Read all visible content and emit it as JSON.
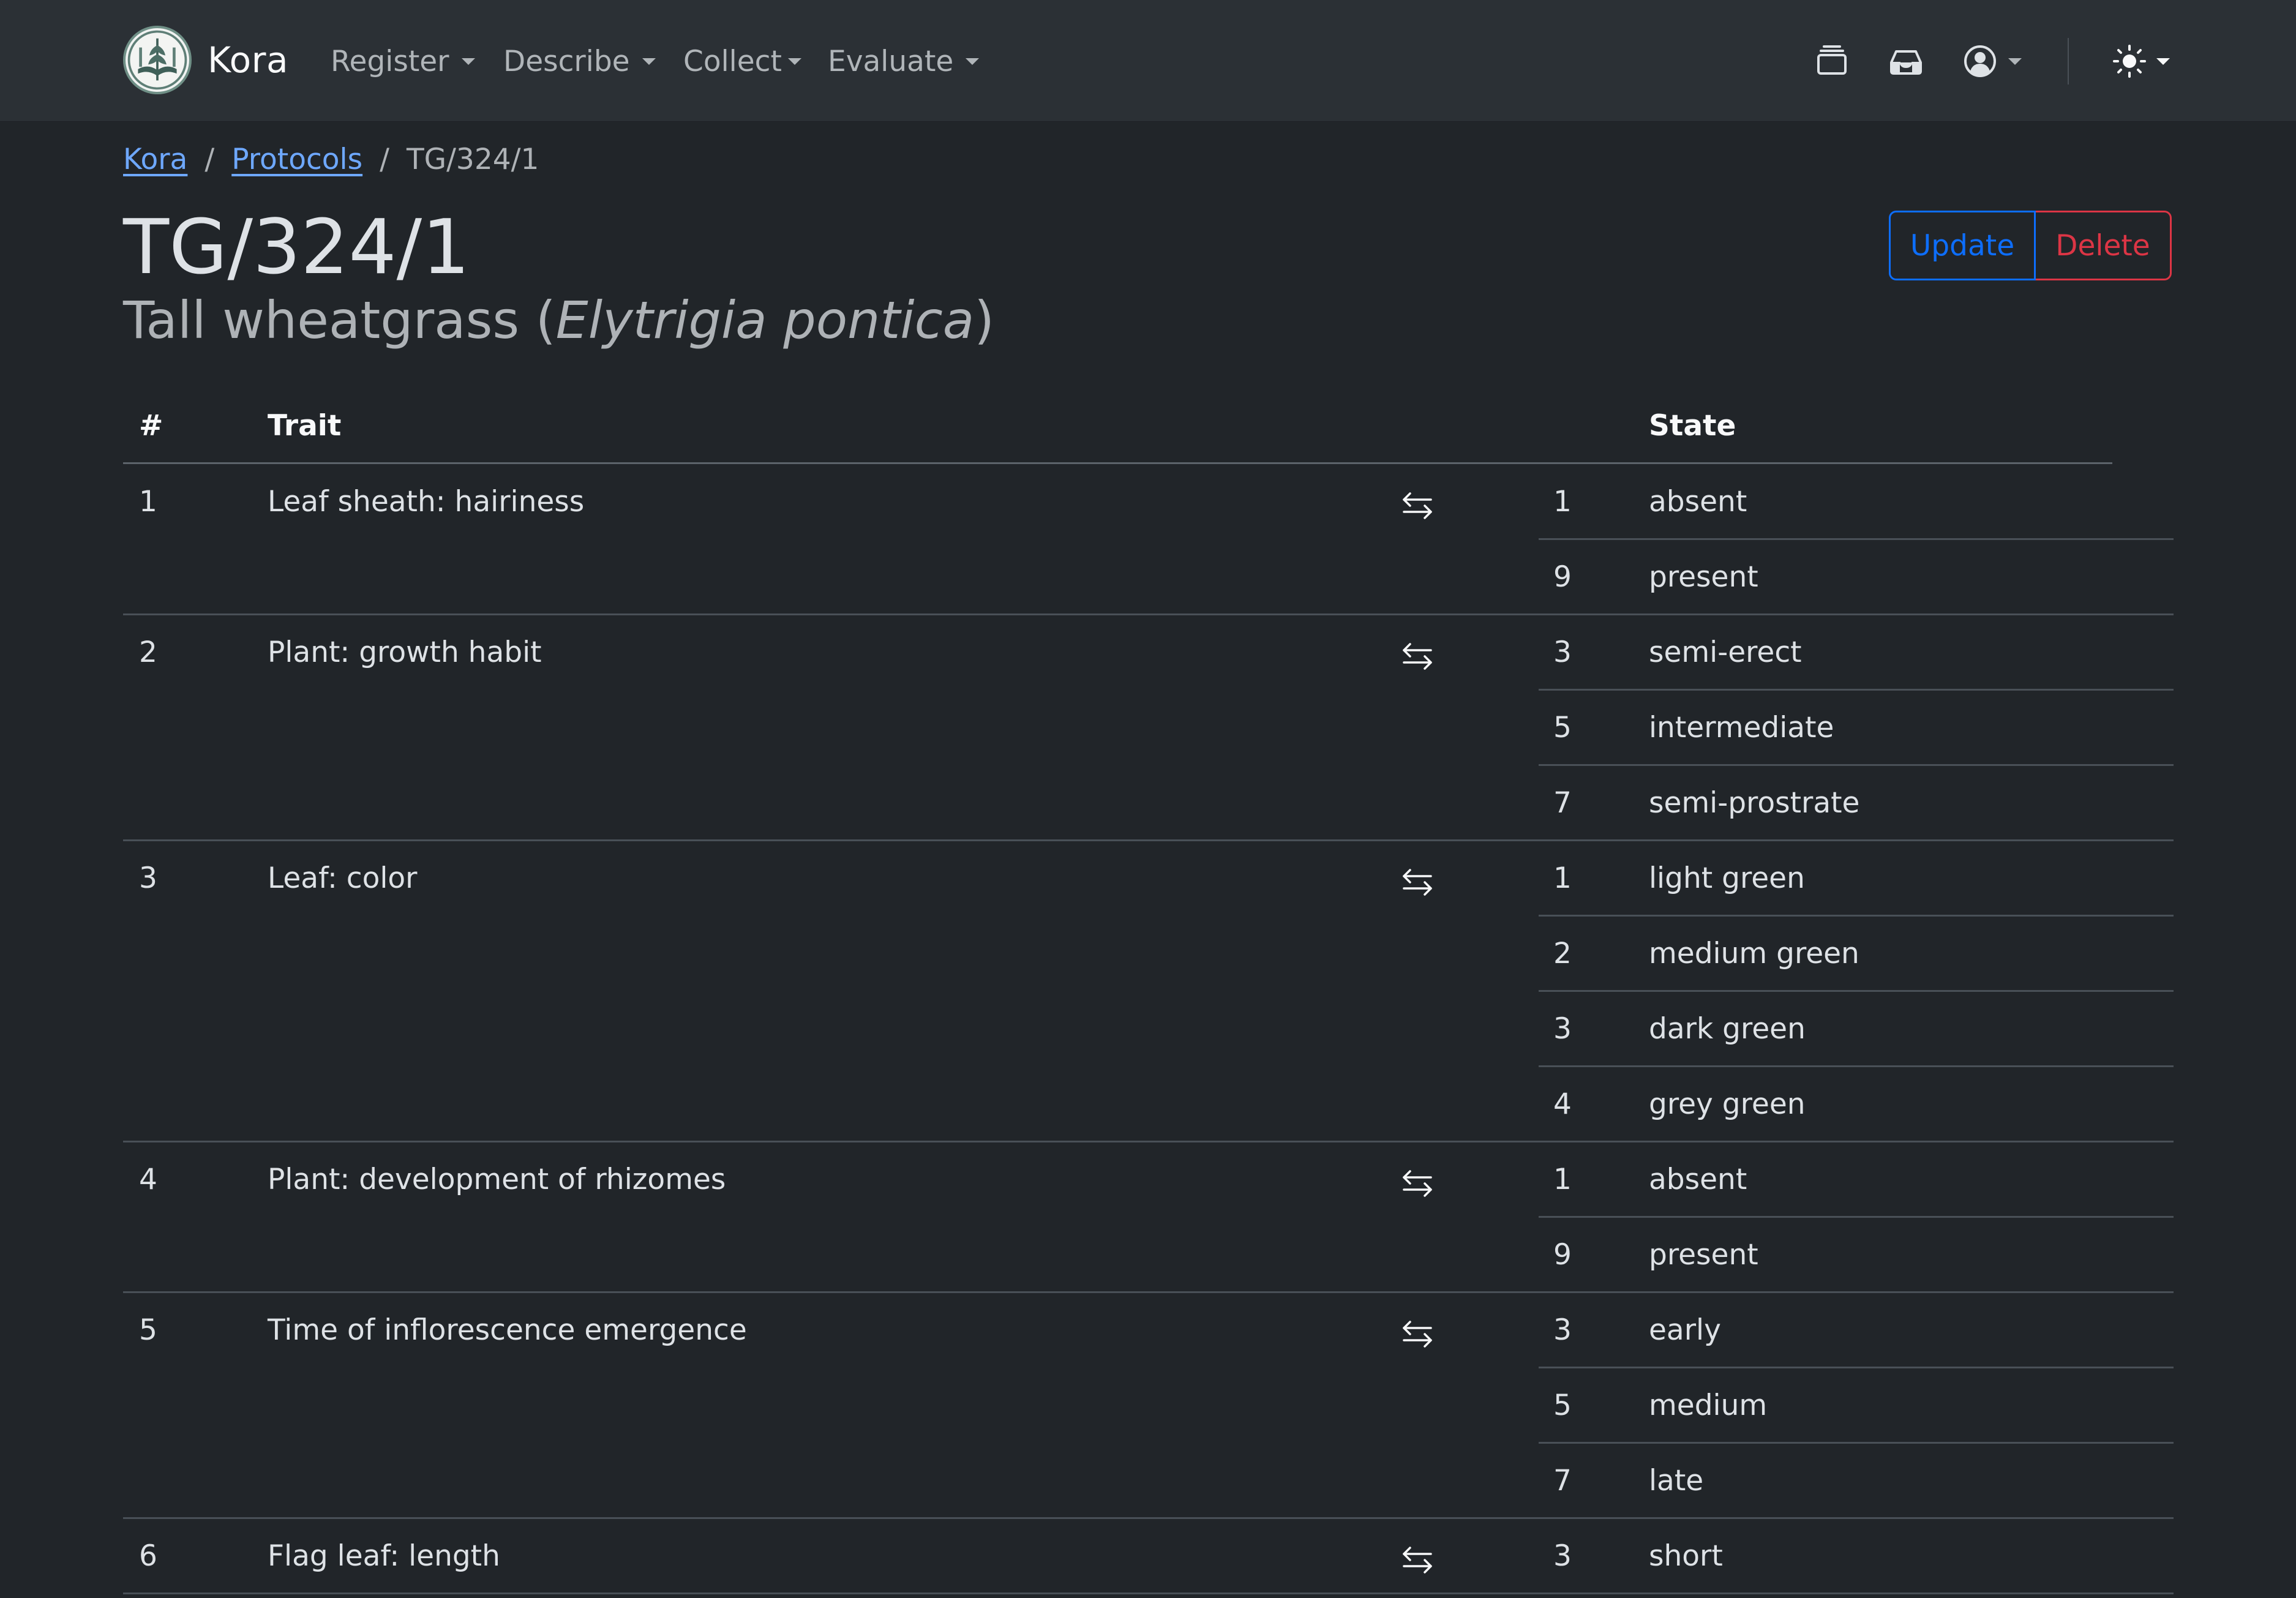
{
  "navbar": {
    "brand": "Kora",
    "menu": [
      {
        "label": "Register"
      },
      {
        "label": "Describe"
      },
      {
        "label": "Collect"
      },
      {
        "label": "Evaluate"
      }
    ],
    "icons": [
      "stack-icon",
      "inbox-icon",
      "user-circle-icon",
      "sun-icon"
    ]
  },
  "breadcrumb": {
    "home": "Kora",
    "section": "Protocols",
    "current": "TG/324/1"
  },
  "page": {
    "title": "TG/324/1",
    "subtitle_common": "Tall wheatgrass (",
    "subtitle_latin": "Elytrigia pontica",
    "subtitle_close": ")"
  },
  "actions": {
    "update": "Update",
    "delete": "Delete"
  },
  "table": {
    "headers": {
      "number": "#",
      "trait": "Trait",
      "state": "State"
    },
    "rows": [
      {
        "num": "1",
        "trait": "Leaf sheath: hairiness",
        "states": [
          {
            "code": "1",
            "label": "absent"
          },
          {
            "code": "9",
            "label": "present"
          }
        ]
      },
      {
        "num": "2",
        "trait": "Plant: growth habit",
        "states": [
          {
            "code": "3",
            "label": "semi-erect"
          },
          {
            "code": "5",
            "label": "intermediate"
          },
          {
            "code": "7",
            "label": "semi-prostrate"
          }
        ]
      },
      {
        "num": "3",
        "trait": "Leaf: color",
        "states": [
          {
            "code": "1",
            "label": "light green"
          },
          {
            "code": "2",
            "label": "medium green"
          },
          {
            "code": "3",
            "label": "dark green"
          },
          {
            "code": "4",
            "label": "grey green"
          }
        ]
      },
      {
        "num": "4",
        "trait": "Plant: development of rhizomes",
        "states": [
          {
            "code": "1",
            "label": "absent"
          },
          {
            "code": "9",
            "label": "present"
          }
        ]
      },
      {
        "num": "5",
        "trait": "Time of inflorescence emergence",
        "states": [
          {
            "code": "3",
            "label": "early"
          },
          {
            "code": "5",
            "label": "medium"
          },
          {
            "code": "7",
            "label": "late"
          }
        ]
      },
      {
        "num": "6",
        "trait": "Flag leaf: length",
        "states": [
          {
            "code": "3",
            "label": "short"
          }
        ]
      }
    ]
  }
}
